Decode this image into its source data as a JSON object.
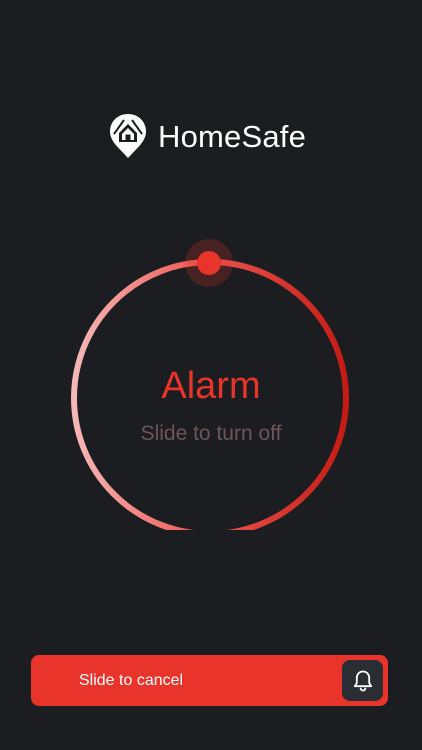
{
  "brand": {
    "name": "HomeSafe",
    "logo_icon": "house-location-pin-icon"
  },
  "alarm": {
    "title": "Alarm",
    "subtitle": "Slide to turn off",
    "knob_position": "top",
    "colors": {
      "accent": "#e8342a",
      "ring_start": "#f6b8b8",
      "ring_end": "#c41c14",
      "subtitle": "#6d555a"
    }
  },
  "cancel": {
    "label": "Slide to cancel",
    "handle_icon": "bell-icon",
    "color": "#e8342a"
  },
  "background": "#1b1d20"
}
